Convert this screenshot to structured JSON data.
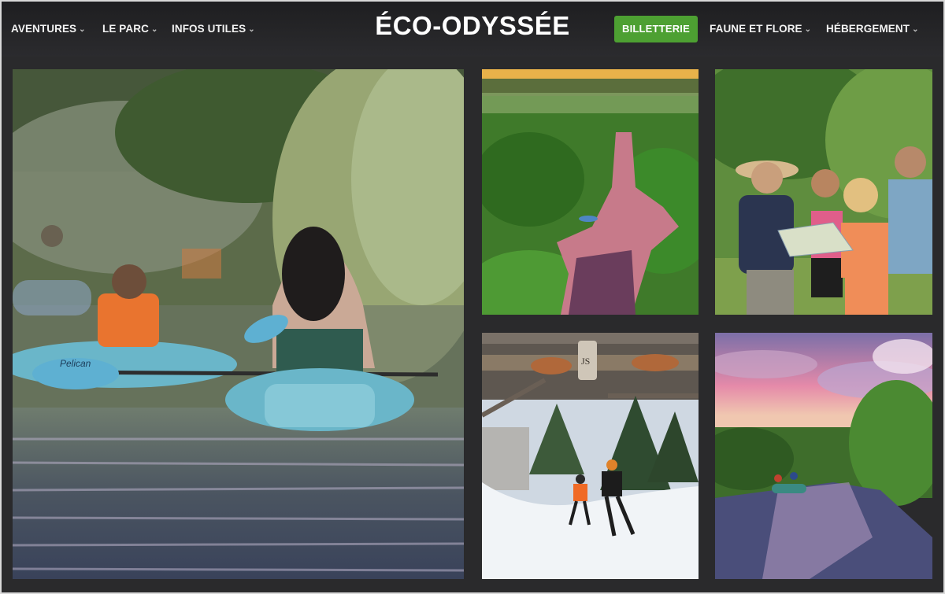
{
  "nav": {
    "left": [
      {
        "label": "AVENTURES"
      },
      {
        "label": "LE PARC"
      },
      {
        "label": "INFOS UTILES"
      }
    ],
    "logo": "ÉCO-ODYSSÉE",
    "ticket_button": "BILLETTERIE",
    "right": [
      {
        "label": "FAUNE ET FLORE"
      },
      {
        "label": "HÉBERGEMENT"
      }
    ],
    "chevron_icon": "chevron-down-icon"
  },
  "photos": {
    "kayak_brand": "Pelican",
    "bridge_sign": "JS"
  },
  "colors": {
    "ticket_green": "#4da032",
    "nav_bg": "#2a2a2c"
  }
}
